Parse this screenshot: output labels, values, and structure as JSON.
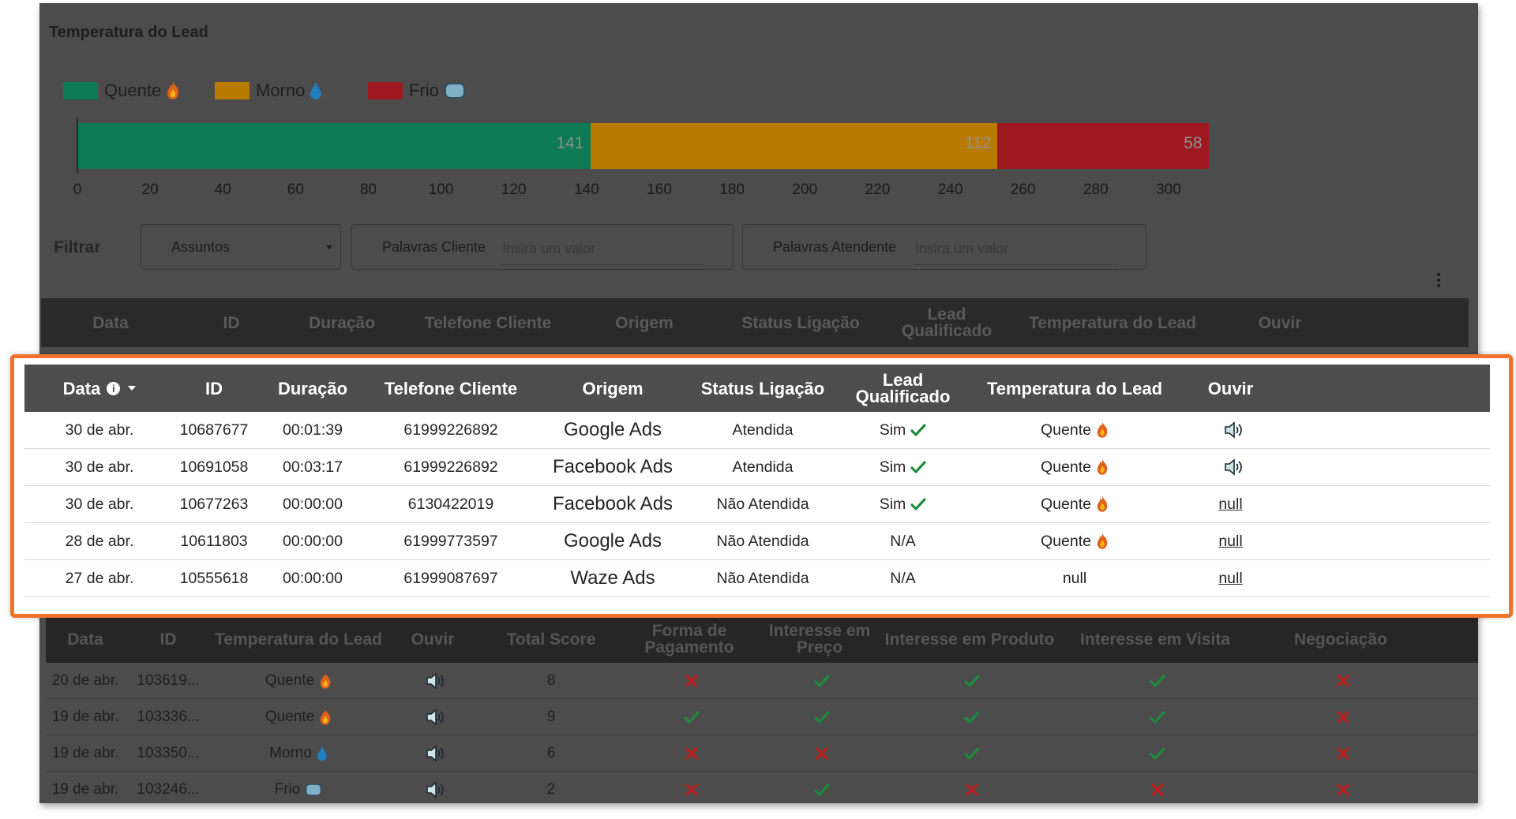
{
  "panel": {
    "title": "Temperatura do Lead"
  },
  "legend": [
    {
      "label": "Quente",
      "color": "#0b7a55",
      "icon": "fire-icon"
    },
    {
      "label": "Morno",
      "color": "#b87a00",
      "icon": "water-drop-icon"
    },
    {
      "label": "Frio",
      "color": "#9e1a20",
      "icon": "ice-cube-icon"
    }
  ],
  "chart_data": {
    "type": "bar",
    "orientation": "horizontal-stacked",
    "series": [
      {
        "name": "Quente",
        "values": [
          141
        ]
      },
      {
        "name": "Morno",
        "values": [
          112
        ]
      },
      {
        "name": "Frio",
        "values": [
          58
        ]
      }
    ],
    "data_labels": [
      "141",
      "112",
      "58"
    ],
    "xlim": [
      0,
      310
    ],
    "xticks": [
      "0",
      "20",
      "40",
      "60",
      "80",
      "100",
      "120",
      "140",
      "160",
      "180",
      "200",
      "220",
      "240",
      "260",
      "280",
      "300"
    ],
    "legend_position": "top-left",
    "grid": false
  },
  "filters": {
    "label": "Filtrar",
    "subjects": "Assuntos",
    "client_words_label": "Palavras Cliente",
    "client_words_placeholder": "Insira um valor",
    "agent_words_label": "Palavras Atendente",
    "agent_words_placeholder": "Insira um valor"
  },
  "dimmed_header": [
    "Data",
    "ID",
    "Duração",
    "Telefone Cliente",
    "Origem",
    "Status Ligação",
    "Lead Qualificado",
    "Temperatura do Lead",
    "Ouvir"
  ],
  "table": {
    "headers": [
      "Data",
      "ID",
      "Duração",
      "Telefone Cliente",
      "Origem",
      "Status Ligação",
      "Lead Qualificado",
      "Temperatura do Lead",
      "Ouvir"
    ],
    "rows": [
      {
        "data": "30 de abr.",
        "id": "10687677",
        "duracao": "00:01:39",
        "telefone": "61999226892",
        "origem": "Google Ads",
        "status": "Atendida",
        "qualificado": "Sim",
        "qualificado_check": true,
        "temperatura": "Quente",
        "temp_icon": "fire-icon",
        "ouvir": "speaker-icon"
      },
      {
        "data": "30 de abr.",
        "id": "10691058",
        "duracao": "00:03:17",
        "telefone": "61999226892",
        "origem": "Facebook Ads",
        "status": "Atendida",
        "qualificado": "Sim",
        "qualificado_check": true,
        "temperatura": "Quente",
        "temp_icon": "fire-icon",
        "ouvir": "speaker-icon"
      },
      {
        "data": "30 de abr.",
        "id": "10677263",
        "duracao": "00:00:00",
        "telefone": "6130422019",
        "origem": "Facebook Ads",
        "status": "Não Atendida",
        "qualificado": "Sim",
        "qualificado_check": true,
        "temperatura": "Quente",
        "temp_icon": "fire-icon",
        "ouvir": "null"
      },
      {
        "data": "28 de abr.",
        "id": "10611803",
        "duracao": "00:00:00",
        "telefone": "61999773597",
        "origem": "Google Ads",
        "status": "Não Atendida",
        "qualificado": "N/A",
        "qualificado_check": false,
        "temperatura": "Quente",
        "temp_icon": "fire-icon",
        "ouvir": "null"
      },
      {
        "data": "27 de abr.",
        "id": "10555618",
        "duracao": "00:00:00",
        "telefone": "61999087697",
        "origem": "Waze Ads",
        "status": "Não Atendida",
        "qualificado": "N/A",
        "qualificado_check": false,
        "temperatura": "null",
        "temp_icon": "",
        "ouvir": "null"
      }
    ]
  },
  "score_table": {
    "headers": [
      "Data",
      "ID",
      "Temperatura do Lead",
      "Ouvir",
      "Total Score",
      "Forma de Pagamento",
      "Interesse em Preço",
      "Interesse em Produto",
      "Interesse em Visita",
      "Negociação"
    ],
    "rows": [
      {
        "data": "20 de abr.",
        "id": "103619...",
        "temperatura": "Quente",
        "temp_icon": "fire-icon",
        "score": "8",
        "flags": [
          false,
          true,
          true,
          true,
          false
        ]
      },
      {
        "data": "19 de abr.",
        "id": "103336...",
        "temperatura": "Quente",
        "temp_icon": "fire-icon",
        "score": "9",
        "flags": [
          true,
          true,
          true,
          true,
          false
        ]
      },
      {
        "data": "19 de abr.",
        "id": "103350...",
        "temperatura": "Morno",
        "temp_icon": "water-drop-icon",
        "score": "6",
        "flags": [
          false,
          false,
          true,
          true,
          false
        ]
      },
      {
        "data": "19 de abr.",
        "id": "103246...",
        "temperatura": "Frio",
        "temp_icon": "ice-cube-icon",
        "score": "2",
        "flags": [
          false,
          true,
          false,
          false,
          false
        ]
      }
    ]
  },
  "colors": {
    "highlight": "#f07329",
    "check": "#1e8a3c",
    "cross": "#b3201d",
    "header_bg": "#4d4d4d"
  }
}
